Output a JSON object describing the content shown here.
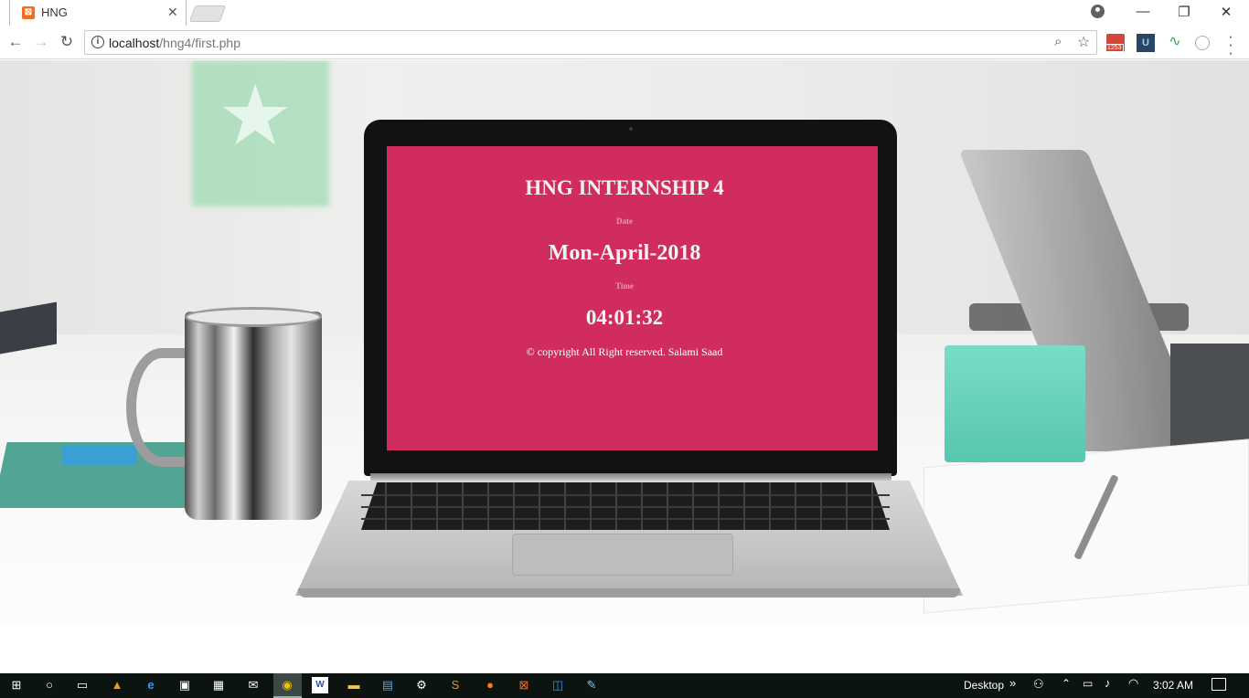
{
  "browser": {
    "tab": {
      "title": "HNG",
      "favicon": "xampp-icon"
    },
    "url": {
      "host": "localhost",
      "path": "/hng4/first.php"
    },
    "extensions": {
      "mail_badge": "1253"
    }
  },
  "page": {
    "title": "HNG INTERNSHIP 4",
    "date_label": "Date",
    "date_value": "Mon-April-2018",
    "time_label": "Time",
    "time_value": "04:01:32",
    "footer": "© copyright All Right reserved. Salami Saad",
    "screen_color": "#d02c5f"
  },
  "taskbar": {
    "desktop_label": "Desktop",
    "clock": "3:02 AM",
    "pinned": [
      "start-icon",
      "cortana-icon",
      "task-view-icon",
      "vlc-icon",
      "edge-icon",
      "store-icon",
      "calculator-icon",
      "mail-icon",
      "chrome-icon",
      "word-icon",
      "file-explorer-icon",
      "notepad-icon",
      "settings-icon",
      "sublime-icon",
      "firefox-icon",
      "xampp-icon",
      "app-icon",
      "paint-icon"
    ]
  }
}
